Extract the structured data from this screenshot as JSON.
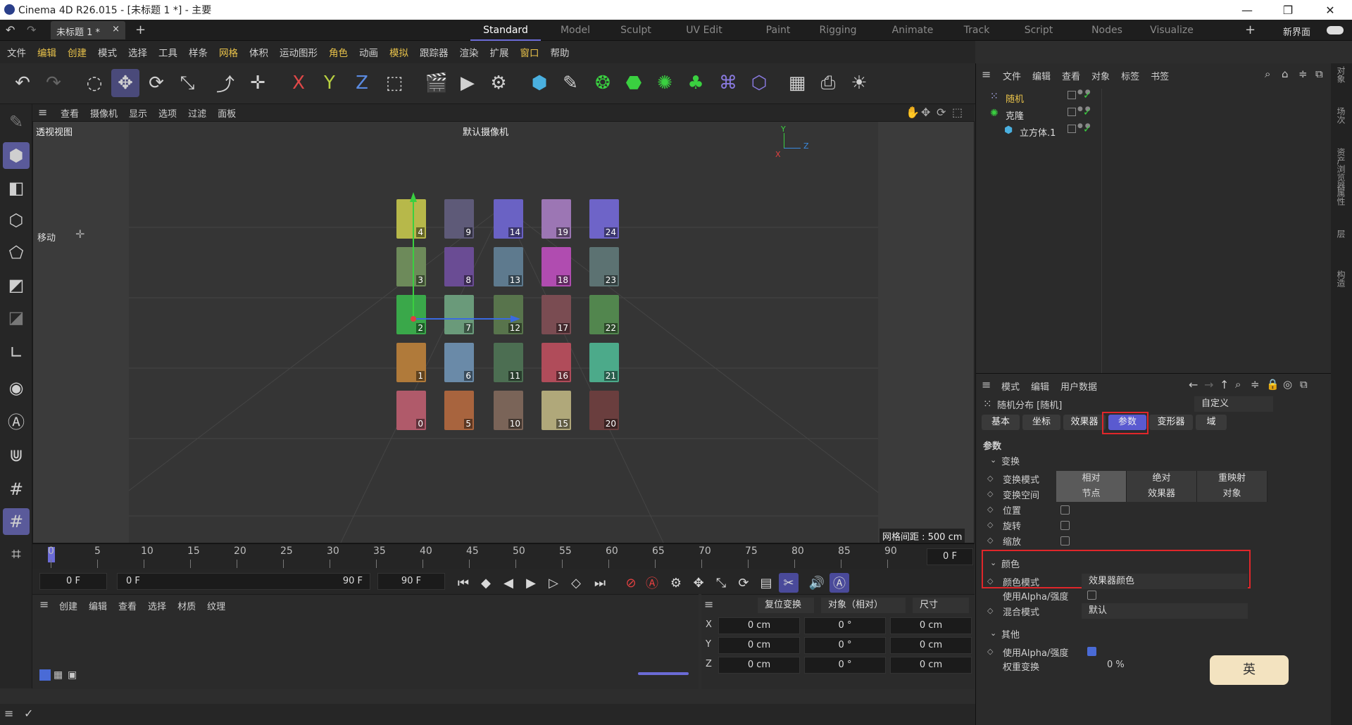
{
  "window": {
    "title": "Cinema 4D R26.015 - [未标题 1 *] - 主要",
    "minimize": "—",
    "restore": "❐",
    "close": "✕"
  },
  "tabs": {
    "doc_tab": "未标题 1 *",
    "doc_close": "×",
    "add": "+",
    "workspaces": [
      "Standard",
      "Model",
      "Sculpt",
      "UV Edit",
      "Paint",
      "Rigging",
      "Animate",
      "Track",
      "Script",
      "Nodes",
      "Visualize"
    ],
    "active": "Standard",
    "new_ui": "新界面",
    "add_ws": "+"
  },
  "menu": [
    "文件",
    "编辑",
    "创建",
    "模式",
    "选择",
    "工具",
    "样条",
    "网格",
    "体积",
    "运动图形",
    "角色",
    "动画",
    "模拟",
    "跟踪器",
    "渲染",
    "扩展",
    "窗口",
    "帮助"
  ],
  "menu_highlight": [
    "编辑",
    "创建",
    "网格",
    "角色",
    "模拟",
    "窗口"
  ],
  "viewport": {
    "menu": [
      "查看",
      "摄像机",
      "显示",
      "选项",
      "过滤",
      "面板"
    ],
    "label": "透视视图",
    "camera": "默认摄像机",
    "move_label": "移动",
    "grid": "网格间距 : 500 cm",
    "axis": {
      "x": "X",
      "y": "Y",
      "z": "Z"
    },
    "cubes": [
      {
        "n": "4",
        "c": "#b7b84a",
        "col": 0,
        "row": 0
      },
      {
        "n": "9",
        "c": "#5e5a78",
        "col": 1,
        "row": 0
      },
      {
        "n": "14",
        "c": "#6a62c4",
        "col": 2,
        "row": 0
      },
      {
        "n": "19",
        "c": "#9c76b4",
        "col": 3,
        "row": 0
      },
      {
        "n": "24",
        "c": "#6e64c8",
        "col": 4,
        "row": 0
      },
      {
        "n": "3",
        "c": "#6d8a5a",
        "col": 0,
        "row": 1
      },
      {
        "n": "8",
        "c": "#6a4c94",
        "col": 1,
        "row": 1
      },
      {
        "n": "13",
        "c": "#5e7a8e",
        "col": 2,
        "row": 1
      },
      {
        "n": "18",
        "c": "#b04cb0",
        "col": 3,
        "row": 1
      },
      {
        "n": "23",
        "c": "#5c7272",
        "col": 4,
        "row": 1
      },
      {
        "n": "2",
        "c": "#3aa84a",
        "col": 0,
        "row": 2
      },
      {
        "n": "7",
        "c": "#6a9a7a",
        "col": 1,
        "row": 2
      },
      {
        "n": "12",
        "c": "#58744c",
        "col": 2,
        "row": 2
      },
      {
        "n": "17",
        "c": "#7a4c52",
        "col": 3,
        "row": 2
      },
      {
        "n": "22",
        "c": "#52864e",
        "col": 4,
        "row": 2
      },
      {
        "n": "1",
        "c": "#b07a3a",
        "col": 0,
        "row": 3
      },
      {
        "n": "6",
        "c": "#6a8aa8",
        "col": 1,
        "row": 3
      },
      {
        "n": "11",
        "c": "#4c6e52",
        "col": 2,
        "row": 3
      },
      {
        "n": "16",
        "c": "#b04c5a",
        "col": 3,
        "row": 3
      },
      {
        "n": "21",
        "c": "#4caa8a",
        "col": 4,
        "row": 3
      },
      {
        "n": "0",
        "c": "#b05a6a",
        "col": 0,
        "row": 4
      },
      {
        "n": "5",
        "c": "#a8643e",
        "col": 1,
        "row": 4
      },
      {
        "n": "10",
        "c": "#7a6458",
        "col": 2,
        "row": 4
      },
      {
        "n": "15",
        "c": "#b0a87a",
        "col": 3,
        "row": 4
      },
      {
        "n": "20",
        "c": "#6a3e3e",
        "col": 4,
        "row": 4
      }
    ]
  },
  "timeline": {
    "ticks": [
      "0",
      "5",
      "10",
      "15",
      "20",
      "25",
      "30",
      "35",
      "40",
      "45",
      "50",
      "55",
      "60",
      "65",
      "70",
      "75",
      "80",
      "85",
      "90"
    ],
    "end": "0 F",
    "start_field": "0 F",
    "range_start": "0 F",
    "range_end": "90 F",
    "end_field": "90 F"
  },
  "material": {
    "menu": [
      "创建",
      "编辑",
      "查看",
      "选择",
      "材质",
      "纹理"
    ]
  },
  "coords": {
    "reset": "复位变换",
    "mode": "对象（相对）",
    "size": "尺寸",
    "rows": [
      {
        "axis": "X",
        "p": "0 cm",
        "r": "0 °",
        "s": "0 cm"
      },
      {
        "axis": "Y",
        "p": "0 cm",
        "r": "0 °",
        "s": "0 cm"
      },
      {
        "axis": "Z",
        "p": "0 cm",
        "r": "0 °",
        "s": "0 cm"
      }
    ]
  },
  "objects": {
    "menu": [
      "文件",
      "编辑",
      "查看",
      "对象",
      "标签",
      "书签"
    ],
    "items": [
      {
        "name": "随机",
        "level": 0
      },
      {
        "name": "克隆",
        "level": 0
      },
      {
        "name": "立方体.1",
        "level": 1
      }
    ]
  },
  "attributes": {
    "menu": [
      "模式",
      "编辑",
      "用户数据"
    ],
    "object": "随机分布 [随机]",
    "preset": "自定义",
    "tabs": [
      "基本",
      "坐标",
      "效果器",
      "参数",
      "变形器",
      "域"
    ],
    "active_tab": "参数",
    "section": "参数",
    "transform": {
      "title": "变换",
      "mode_label": "变换模式",
      "mode_opts": [
        "相对",
        "绝对",
        "重映射"
      ],
      "space_label": "变换空间",
      "space_opts": [
        "节点",
        "效果器",
        "对象"
      ],
      "pos": "位置",
      "rot": "旋转",
      "scale": "缩放"
    },
    "color": {
      "title": "颜色",
      "mode_label": "颜色模式",
      "mode_value": "效果器颜色",
      "alpha": "使用Alpha/强度",
      "blend": "混合模式",
      "blend_value": "默认"
    },
    "other": {
      "title": "其他",
      "alpha": "使用Alpha/强度",
      "weight": "权重变换",
      "weight_value": "0 %"
    }
  },
  "sidetabs": [
    "对象",
    "场次",
    "资产浏览器",
    "属性",
    "层",
    "构造"
  ],
  "ime": "英"
}
